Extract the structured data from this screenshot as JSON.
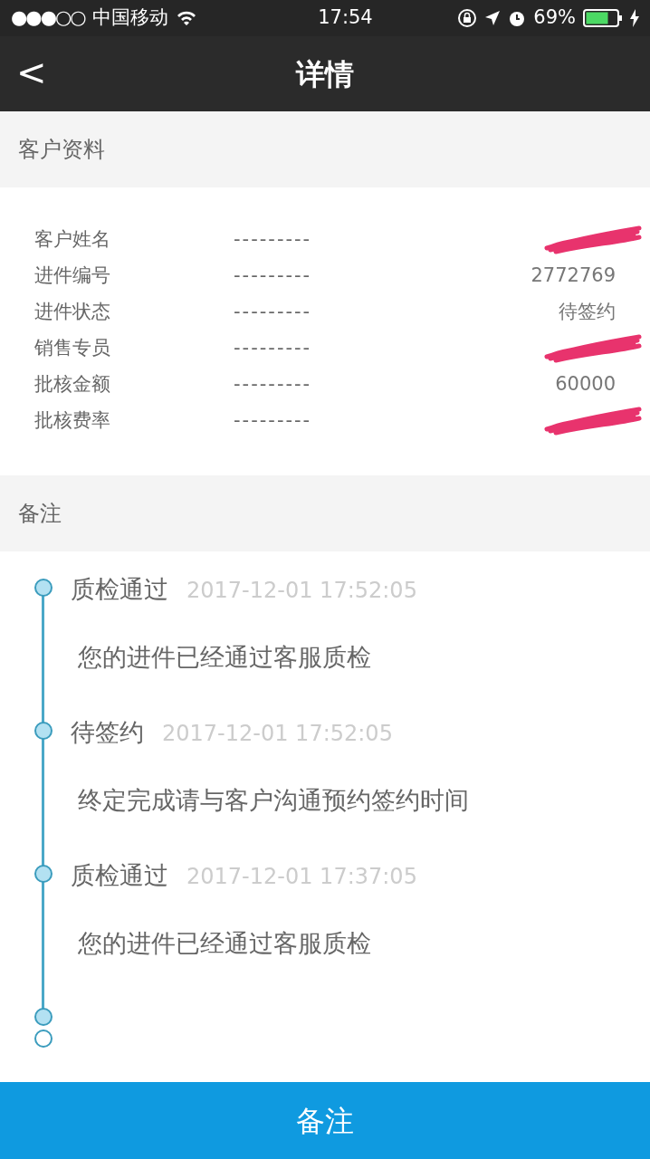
{
  "status_bar": {
    "signal": "●●●○○",
    "carrier": "中国移动",
    "time": "17:54",
    "battery": "69%"
  },
  "nav": {
    "back": "<",
    "title": "详情"
  },
  "customer_section": {
    "title": "客户资料",
    "rows": [
      {
        "label": "客户姓名",
        "dashes": "---------",
        "redacted": true
      },
      {
        "label": "进件编号",
        "dashes": "---------",
        "value": "2772769",
        "redacted": false
      },
      {
        "label": "进件状态",
        "dashes": "---------",
        "value": "待签约",
        "redacted": false
      },
      {
        "label": "销售专员",
        "dashes": "---------",
        "redacted": true
      },
      {
        "label": "批核金额",
        "dashes": "---------",
        "value": "60000",
        "redacted": false
      },
      {
        "label": "批核费率",
        "dashes": "---------",
        "redacted": true
      }
    ]
  },
  "notes_section": {
    "title": "备注",
    "timeline": [
      {
        "title": "质检通过",
        "time": "2017-12-01 17:52:05",
        "message": "您的进件已经通过客服质检"
      },
      {
        "title": "待签约",
        "time": "2017-12-01 17:52:05",
        "message": "终定完成请与客户沟通预约签约时间"
      },
      {
        "title": "质检通过",
        "time": "2017-12-01 17:37:05",
        "message": "您的进件已经通过客服质检"
      }
    ]
  },
  "bottom_button": {
    "label": "备注"
  }
}
